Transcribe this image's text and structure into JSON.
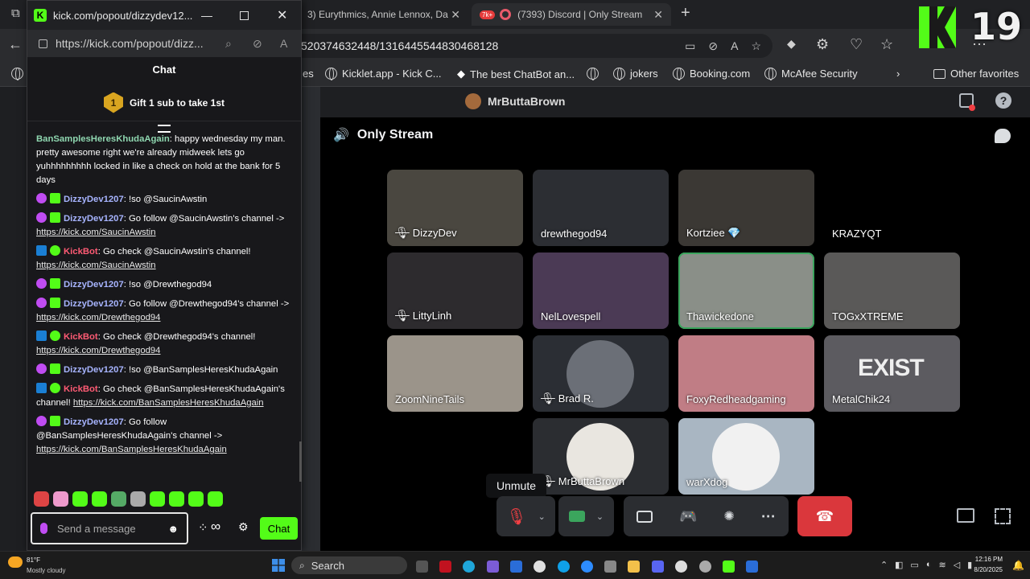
{
  "browser": {
    "tabs": [
      {
        "label": "3) Eurythmics, Annie Lennox, Da",
        "close": "✕"
      },
      {
        "label": "(7393) Discord | Only Stream",
        "badge": "7k+",
        "close": "✕"
      }
    ],
    "url": "520374632448/1316445544830468128",
    "bookmarks": [
      "es",
      "Kicklet.app - Kick C...",
      "The best ChatBot an...",
      "jokers",
      "Booking.com",
      "McAfee Security"
    ],
    "other_favorites": "Other favorites"
  },
  "kick_overlay": {
    "number": "19"
  },
  "discord": {
    "server_user": "MrButtaBrown",
    "channel": "Only Stream",
    "participants": [
      {
        "name": "DizzyDev",
        "muted": true
      },
      {
        "name": "drewthegod94",
        "muted": false
      },
      {
        "name": "Kortziee 💎",
        "muted": false
      },
      {
        "name": "KRAZYQT",
        "muted": false
      },
      {
        "name": "LittyLinh",
        "muted": true
      },
      {
        "name": "NelLovespell",
        "muted": false
      },
      {
        "name": "Thawickedone",
        "muted": false,
        "speaking": true
      },
      {
        "name": "TOGxXTREME",
        "muted": false
      },
      {
        "name": "ZoomNineTails",
        "muted": false
      },
      {
        "name": "Brad R.",
        "muted": true
      },
      {
        "name": "FoxyRedheadgaming",
        "muted": false
      },
      {
        "name": "MetalChik24",
        "muted": false
      },
      {
        "name": "MrButtaBrown",
        "muted": true
      },
      {
        "name": "warXdog",
        "muted": false
      }
    ],
    "exist_text": "EXIST",
    "tooltip": "Unmute"
  },
  "kick": {
    "window_title": "kick.com/popout/dizzydev12...",
    "url": "https://kick.com/popout/dizz...",
    "chat_header": "Chat",
    "gift_text": "Gift 1 sub to take 1st",
    "gift_rank": "1",
    "messages": [
      {
        "badges": [],
        "user": "BanSamplesHeresKhudaAgain",
        "cls": "u-green",
        "text": "happy wednesday my man. pretty awesome right we're already midweek lets go yuhhhhhhhhh locked in like a check on hold at the bank for 5 days",
        "link": ""
      },
      {
        "badges": [
          "mic",
          "sub"
        ],
        "user": "DizzyDev1207",
        "cls": "u-blue",
        "text": "!so @SaucinAwstin",
        "link": ""
      },
      {
        "badges": [
          "mic",
          "sub"
        ],
        "user": "DizzyDev1207",
        "cls": "u-blue",
        "text": "Go follow @SaucinAwstin's channel -> ",
        "link": "https://kick.com/SaucinAwstin"
      },
      {
        "badges": [
          "bot",
          "ver"
        ],
        "user": "KickBot",
        "cls": "u-red",
        "text": "Go check @SaucinAwstin's channel! ",
        "link": "https://kick.com/SaucinAwstin"
      },
      {
        "badges": [
          "mic",
          "sub"
        ],
        "user": "DizzyDev1207",
        "cls": "u-blue",
        "text": "!so @Drewthegod94",
        "link": ""
      },
      {
        "badges": [
          "mic",
          "sub"
        ],
        "user": "DizzyDev1207",
        "cls": "u-blue",
        "text": "Go follow @Drewthegod94's channel -> ",
        "link": "https://kick.com/Drewthegod94"
      },
      {
        "badges": [
          "bot",
          "ver"
        ],
        "user": "KickBot",
        "cls": "u-red",
        "text": "Go check @Drewthegod94's channel! ",
        "link": "https://kick.com/Drewthegod94"
      },
      {
        "badges": [
          "mic",
          "sub"
        ],
        "user": "DizzyDev1207",
        "cls": "u-blue",
        "text": "!so @BanSamplesHeresKhudaAgain",
        "link": ""
      },
      {
        "badges": [
          "bot",
          "ver"
        ],
        "user": "KickBot",
        "cls": "u-red",
        "text": "Go check @BanSamplesHeresKhudaAgain's channel! ",
        "link": "https://kick.com/BanSamplesHeresKhudaAgain"
      },
      {
        "badges": [
          "mic",
          "sub"
        ],
        "user": "DizzyDev1207",
        "cls": "u-blue",
        "text": "Go follow @BanSamplesHeresKhudaAgain's channel -> ",
        "link": "https://kick.com/BanSamplesHeresKhudaAgain"
      }
    ],
    "input_placeholder": "Send a message",
    "chat_button": "Chat"
  },
  "taskbar": {
    "weather_temp": "81°F",
    "weather_desc": "Mostly cloudy",
    "search": "Search",
    "time": "12:16 PM",
    "date": "8/20/2025"
  }
}
